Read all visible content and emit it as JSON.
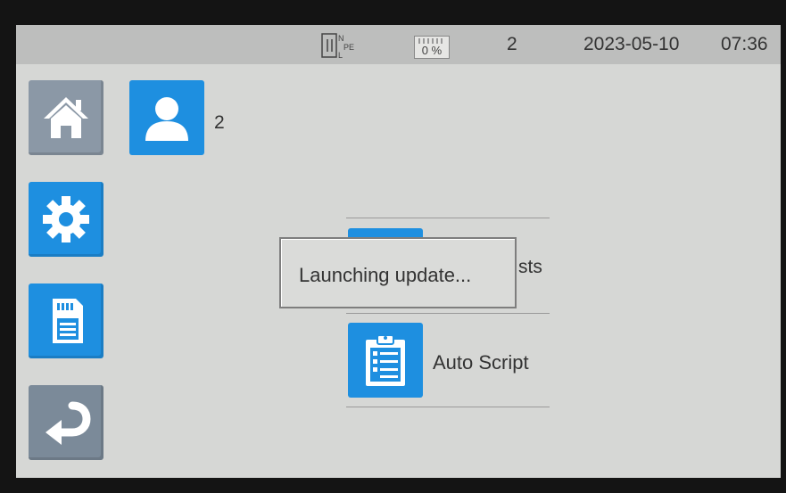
{
  "status_bar": {
    "plug_n": "N",
    "plug_pe": "PE",
    "plug_l": "L",
    "battery_level": "0 %",
    "user_count": "2",
    "date": "2023-05-10",
    "time": "07:36"
  },
  "sidebar": {
    "items": [
      {
        "icon": "home-icon"
      },
      {
        "icon": "gear-icon"
      },
      {
        "icon": "sd-card-icon"
      },
      {
        "icon": "back-arrow-icon"
      }
    ]
  },
  "user": {
    "icon": "user-icon",
    "count": "2"
  },
  "menu": {
    "item_behind_dialog_visible_text": "sts",
    "auto_script_label": "Auto Script",
    "auto_script_icon": "clipboard-checklist-icon"
  },
  "dialog": {
    "message": "Launching update..."
  },
  "colors": {
    "accent_blue": "#1e8fe0",
    "screen_bg": "#d6d7d5",
    "status_bar_bg": "#bdbebd"
  }
}
